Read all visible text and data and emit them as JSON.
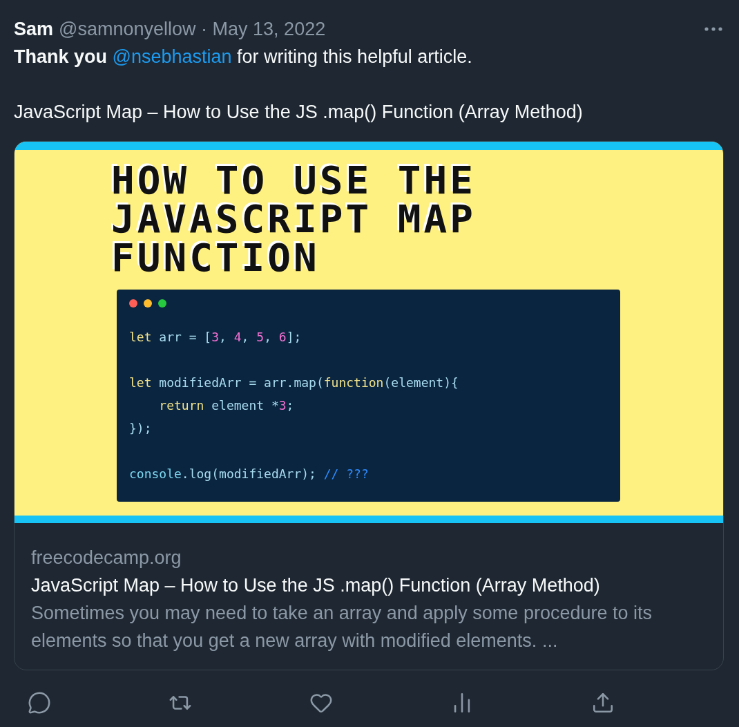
{
  "author": {
    "name": "Sam",
    "handle": "@samnonyellow",
    "separator": "·",
    "date": "May 13, 2022"
  },
  "text": {
    "bold_lead": "Thank you",
    "mention": "@nsebhastian",
    "rest": " for writing this helpful article."
  },
  "article_title": "JavaScript Map – How to Use the JS .map() Function (Array Method)",
  "card": {
    "image": {
      "headline": [
        "HOW TO USE THE",
        "JAVASCRIPT MAP",
        "FUNCTION"
      ],
      "window_dots": [
        {
          "color": "#ff5f56"
        },
        {
          "color": "#ffbd2e"
        },
        {
          "color": "#27c93f"
        }
      ],
      "code": [
        {
          "kind": "code",
          "tokens": [
            {
              "kind": "keyword",
              "text": "let"
            },
            {
              "kind": "plain",
              "text": " arr = ["
            },
            {
              "kind": "number",
              "text": "3"
            },
            {
              "kind": "plain",
              "text": ", "
            },
            {
              "kind": "number",
              "text": "4"
            },
            {
              "kind": "plain",
              "text": ", "
            },
            {
              "kind": "number",
              "text": "5"
            },
            {
              "kind": "plain",
              "text": ", "
            },
            {
              "kind": "number",
              "text": "6"
            },
            {
              "kind": "plain",
              "text": "];"
            }
          ]
        },
        {
          "kind": "blank"
        },
        {
          "kind": "code",
          "tokens": [
            {
              "kind": "keyword",
              "text": "let"
            },
            {
              "kind": "plain",
              "text": " modifiedArr = arr.map("
            },
            {
              "kind": "keyword",
              "text": "function"
            },
            {
              "kind": "plain",
              "text": "(element){"
            }
          ]
        },
        {
          "kind": "code",
          "tokens": [
            {
              "kind": "keyword",
              "text": "    return"
            },
            {
              "kind": "plain",
              "text": " element *"
            },
            {
              "kind": "number",
              "text": "3"
            },
            {
              "kind": "plain",
              "text": ";"
            }
          ]
        },
        {
          "kind": "code",
          "tokens": [
            {
              "kind": "plain",
              "text": "});"
            }
          ]
        },
        {
          "kind": "blank"
        },
        {
          "kind": "code",
          "tokens": [
            {
              "kind": "builtin",
              "text": "console"
            },
            {
              "kind": "plain",
              "text": ".log(modifiedArr); "
            },
            {
              "kind": "comment",
              "text": "// ???"
            }
          ]
        }
      ]
    },
    "domain": "freecodecamp.org",
    "title": "JavaScript Map – How to Use the JS .map() Function (Array Method)",
    "description": "Sometimes you may need to take an array and apply some procedure to its elements so that you get a new array with modified elements. ..."
  },
  "actions": [
    {
      "kind": "reply"
    },
    {
      "kind": "retweet"
    },
    {
      "kind": "like"
    },
    {
      "kind": "views"
    },
    {
      "kind": "share"
    }
  ]
}
